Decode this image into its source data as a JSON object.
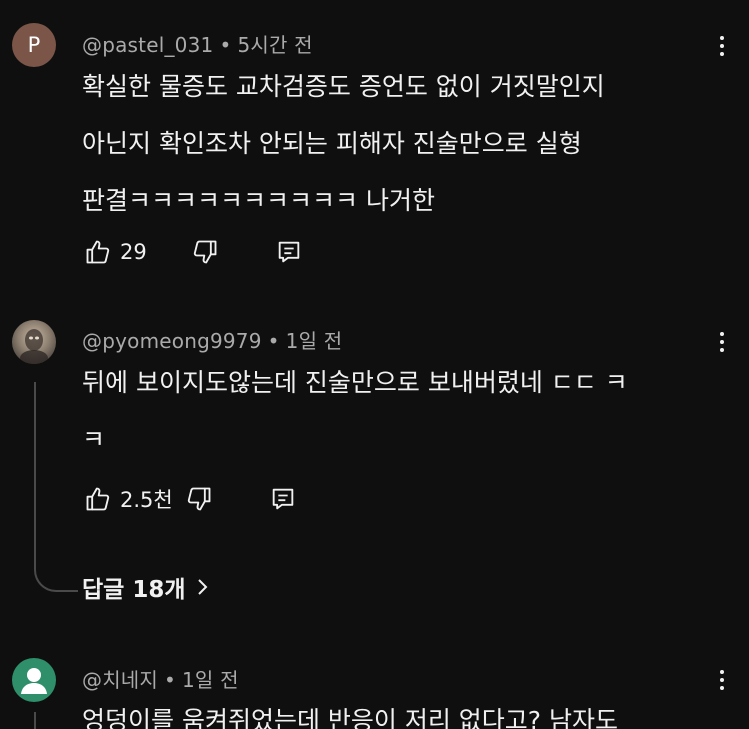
{
  "comments": [
    {
      "avatar_letter": "P",
      "username": "@pastel_031",
      "separator": "•",
      "time": "5시간 전",
      "lines": [
        "확실한 물증도 교차검증도 증언도 없이 거짓말인지",
        "아닌지 확인조차 안되는 피해자 진술만으로 실형",
        "판결ㅋㅋㅋㅋㅋㅋㅋㅋㅋㅋ 나거한"
      ],
      "likes": "29"
    },
    {
      "username": "@pyomeong9979",
      "separator": "•",
      "time": "1일 전",
      "lines": [
        "뒤에 보이지도않는데 진술만으로 보내버렸네 ㄷㄷ ㅋ",
        "ㅋ"
      ],
      "likes": "2.5천",
      "replies_label": "답글 18개"
    },
    {
      "username": "@치네지",
      "separator": "•",
      "time": "1일 전",
      "lines": [
        "엉덩이를 움켜쥐었는데 반응이 저리 없다고? 남자도"
      ]
    }
  ],
  "icons": {
    "like": "thumbs-up-icon",
    "dislike": "thumbs-down-icon",
    "reply": "reply-icon",
    "more": "more-vertical-icon",
    "chevron": "chevron-right-icon",
    "default_avatar": "person-icon"
  },
  "colors": {
    "background": "#0f0f0f",
    "text": "#f1f1f1",
    "meta": "#aaaaaa",
    "avatar_p": "#7a5548",
    "avatar_default": "#2f8f6a"
  }
}
